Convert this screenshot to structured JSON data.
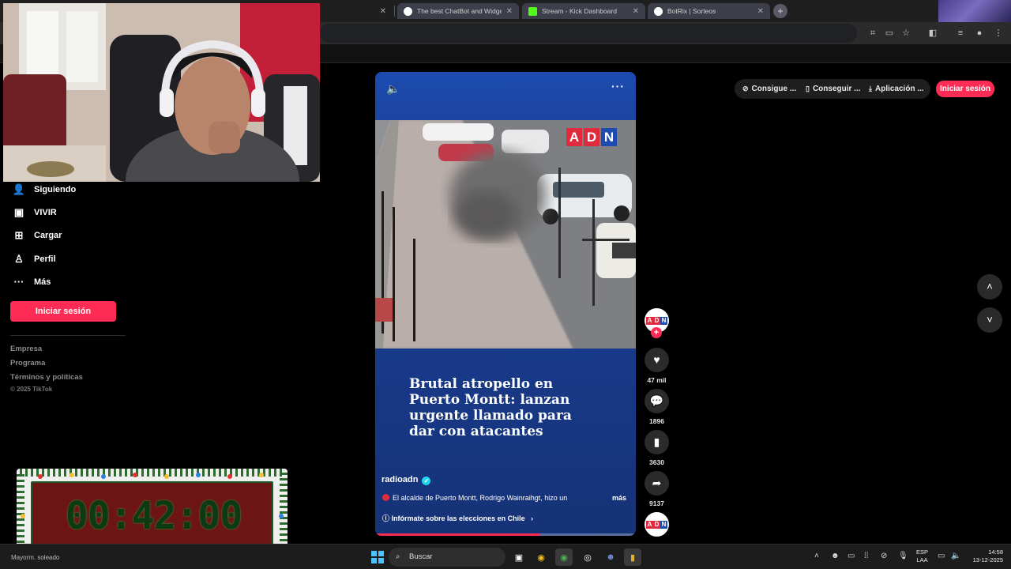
{
  "browser": {
    "tabs": [
      {
        "label": "The best ChatBot and Widgets",
        "icon": "chatbot-favicon"
      },
      {
        "label": "Stream - Kick Dashboard",
        "icon": "kick-favicon"
      },
      {
        "label": "BotRix | Sorteos",
        "icon": "botrix-favicon"
      }
    ]
  },
  "sidebar": {
    "items": [
      {
        "label": "Siguiendo",
        "icon": "following-icon"
      },
      {
        "label": "VIVIR",
        "icon": "live-icon"
      },
      {
        "label": "Cargar",
        "icon": "upload-icon"
      },
      {
        "label": "Perfil",
        "icon": "profile-icon"
      },
      {
        "label": "Más",
        "icon": "more-icon"
      }
    ],
    "login_label": "Iniciar sesión",
    "footer_links": [
      "Empresa",
      "Programa",
      "Términos y políticas"
    ],
    "copyright": "© 2025 TikTok"
  },
  "header": {
    "links": [
      {
        "label": "Consigue ...",
        "icon": "coins-icon"
      },
      {
        "label": "Conseguir ...",
        "icon": "phone-icon"
      },
      {
        "label": "Aplicación ...",
        "icon": "download-icon"
      }
    ],
    "login_label": "Iniciar sesión"
  },
  "video": {
    "logo_letters": [
      "A",
      "D",
      "N"
    ],
    "headline_lines": [
      "Brutal atropello en",
      "Puerto Montt: lanzan",
      "urgente llamado para",
      "dar con atacantes"
    ],
    "author": "radioadn",
    "description": "El alcalde de Puerto Montt, Rodrigo Wainraihgt, hizo un",
    "more_label": "más",
    "info_label": "Infórmate sobre las elecciones en Chile",
    "progress": 0.63
  },
  "actions": {
    "likes": "47 mil",
    "comments": "1896",
    "saves": "3630",
    "shares": "9137"
  },
  "timer": {
    "display": "00:42:00"
  },
  "taskbar": {
    "search_label": "Buscar",
    "weather": "Mayorm. soleado",
    "lang_top": "ESP",
    "lang_bottom": "LAA",
    "time": "14:58",
    "date": "13-12-2025"
  },
  "colors": {
    "accent": "#fe2c55",
    "video_blue": "#1a3f96",
    "adn_red": "#e02b3c",
    "adn_blue": "#1d4bb0"
  }
}
